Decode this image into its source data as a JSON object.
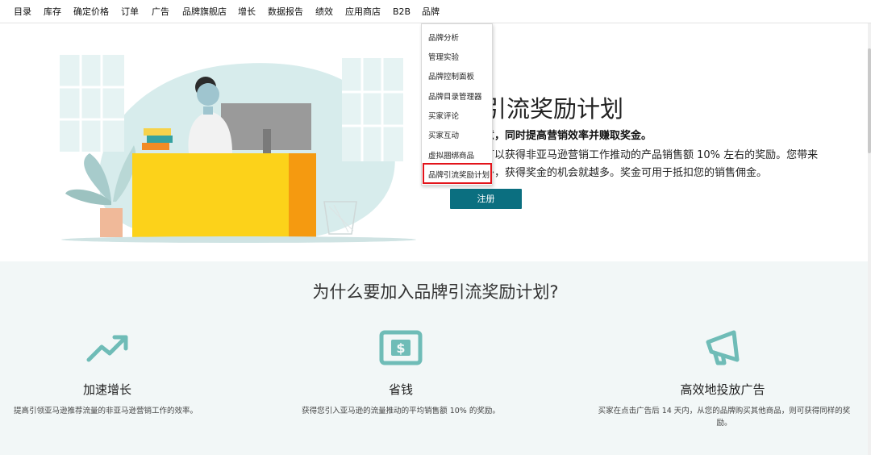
{
  "nav": {
    "items": [
      "目录",
      "库存",
      "确定价格",
      "订单",
      "广告",
      "品牌旗舰店",
      "增长",
      "数据报告",
      "绩效",
      "应用商店",
      "B2B",
      "品牌"
    ]
  },
  "dropdown": {
    "items": [
      "品牌分析",
      "管理实验",
      "品牌控制面板",
      "品牌目录管理器",
      "买家评论",
      "买家互动",
      "虚拟捆绑商品",
      "品牌引流奖励计划"
    ],
    "highlighted": "品牌引流奖励计划",
    "highlight_color": "#e3141b"
  },
  "hero": {
    "title": "牌引流奖励计划",
    "subtitle": "意，同时提高营销效率并赚取奖金。",
    "line1": "可以获得非亚马逊营销工作推动的产品销售额 10% 左右的奖励。您带来",
    "line2": "多，获得奖金的机会就越多。奖金可用于抵扣您的销售佣金。",
    "register_label": "注册",
    "register_color": "#0b6f80"
  },
  "why": {
    "title": "为什么要加入品牌引流奖励计划?",
    "features": [
      {
        "icon": "trend-up-icon",
        "title": "加速增长",
        "desc": "提高引领亚马逊推荐流量的非亚马逊营销工作的效率。"
      },
      {
        "icon": "dollar-bill-icon",
        "title": "省钱",
        "desc": "获得您引入亚马逊的流量推动的平均销售额 10% 的奖励。"
      },
      {
        "icon": "megaphone-icon",
        "title": "高效地投放广告",
        "desc": "买家在点击广告后 14 天内，从您的品牌购买其他商品，则可获得同样的奖励。"
      }
    ],
    "icon_color": "#6fbcb7"
  }
}
